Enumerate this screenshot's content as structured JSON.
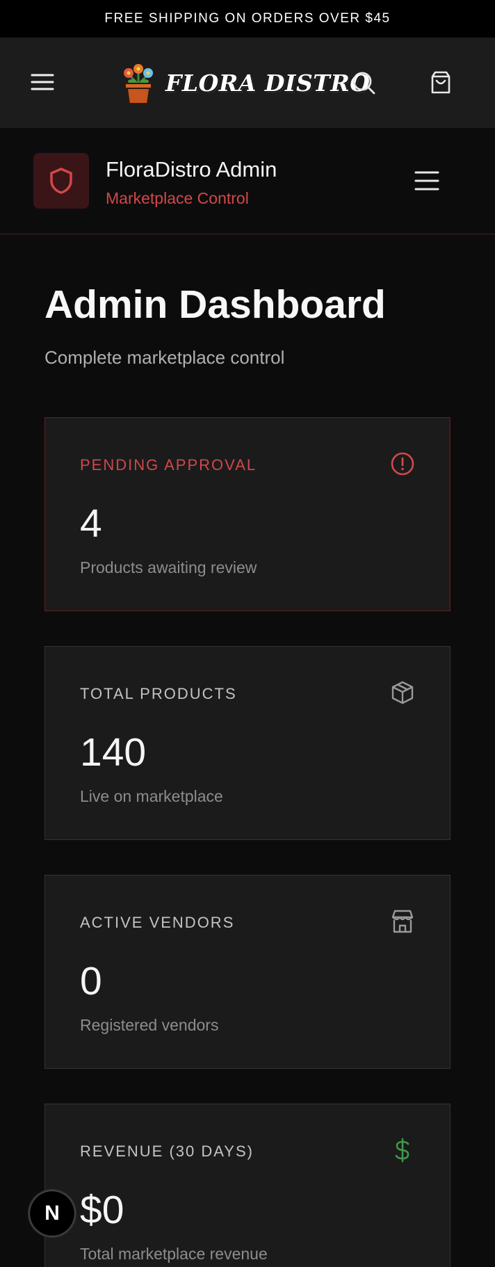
{
  "announcement": "FREE SHIPPING ON ORDERS OVER $45",
  "brand": {
    "name": "FLORA DISTRO"
  },
  "admin_header": {
    "title": "FloraDistro Admin",
    "subtitle": "Marketplace Control"
  },
  "page": {
    "title": "Admin Dashboard",
    "subtitle": "Complete marketplace control"
  },
  "cards": [
    {
      "label": "PENDING APPROVAL",
      "value": "4",
      "desc": "Products awaiting review",
      "icon": "alert-circle-icon"
    },
    {
      "label": "TOTAL PRODUCTS",
      "value": "140",
      "desc": "Live on marketplace",
      "icon": "package-icon"
    },
    {
      "label": "ACTIVE VENDORS",
      "value": "0",
      "desc": "Registered vendors",
      "icon": "store-icon"
    },
    {
      "label": "REVENUE (30 DAYS)",
      "value": "$0",
      "desc": "Total marketplace revenue",
      "icon": "dollar-icon"
    }
  ],
  "dev_badge": "N",
  "colors": {
    "accent_red": "#d24848",
    "revenue_green": "#3f9a4a",
    "card_bg": "#1b1b1c",
    "page_bg": "#0c0c0d"
  }
}
